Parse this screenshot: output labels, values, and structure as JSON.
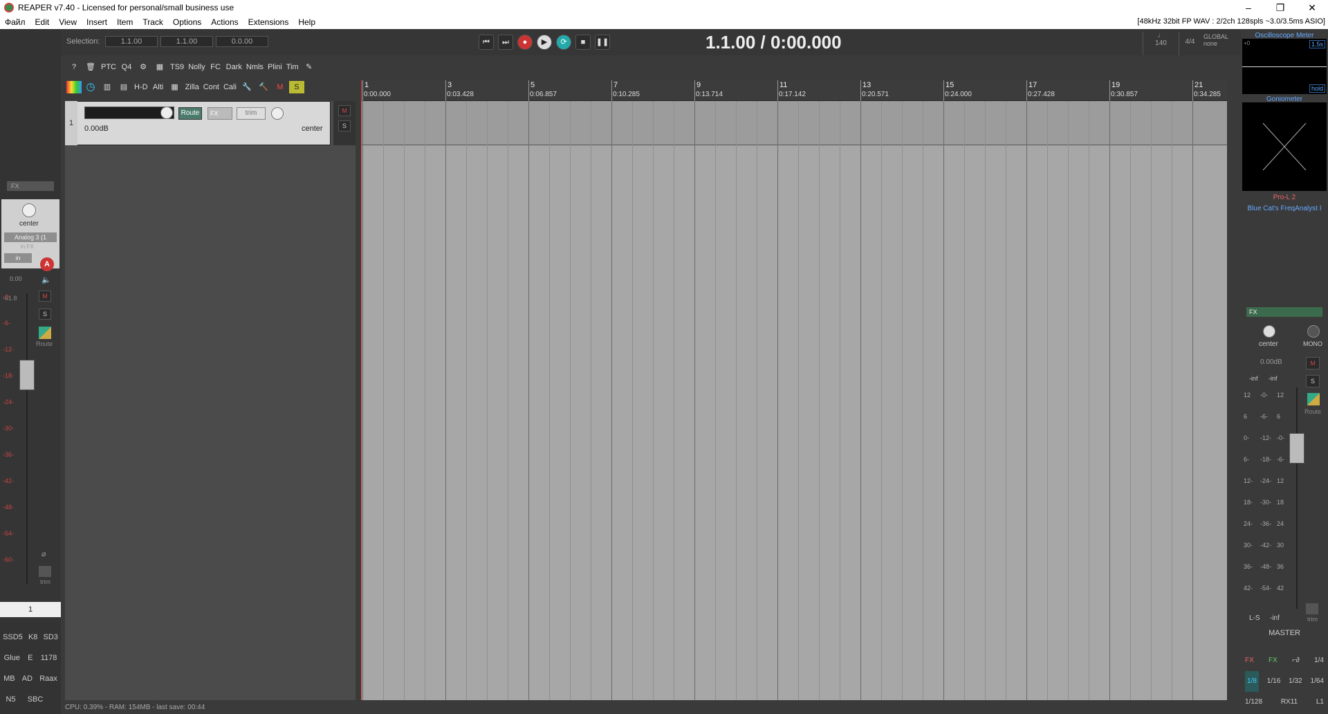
{
  "window": {
    "title": "REAPER v7.40 - Licensed for personal/small business use",
    "controls": [
      "–",
      "❐",
      "✕"
    ]
  },
  "menu": {
    "items": [
      "Файл",
      "Edit",
      "View",
      "Insert",
      "Item",
      "Track",
      "Options",
      "Actions",
      "Extensions",
      "Help"
    ],
    "status": "[48kHz 32bit FP WAV : 2/2ch 128spls ~3.0/3.5ms ASIO]"
  },
  "selection": {
    "label": "Selection:",
    "start": "1.1.00",
    "end": "1.1.00",
    "length": "0.0.00"
  },
  "transport": {
    "time": "1.1.00 / 0:00.000",
    "bpm": "140",
    "timesig": "4/4",
    "global_label": "GLOBAL",
    "global_value": "none"
  },
  "toolbar2": [
    "?",
    "🗑",
    "PTC",
    "Q4",
    "⚙",
    "▦",
    "TS9",
    "Nolly",
    "FC",
    "Dark",
    "Nmls",
    "Plini",
    "Tim",
    "✎"
  ],
  "toolbar3": [
    "",
    "◷",
    "▥",
    "▤",
    "H-D",
    "Alti",
    "▦",
    "Zilla",
    "Cont",
    "Cali",
    "🔧",
    "🔨",
    "M",
    "S"
  ],
  "track": {
    "number": "1",
    "route": "Route",
    "fx": "FX",
    "trim": "trim",
    "volume": "0.00dB",
    "pan": "center",
    "mute": "M",
    "solo": "S"
  },
  "ruler": [
    {
      "bar": "1",
      "time": "0:00.000"
    },
    {
      "bar": "3",
      "time": "0:03.428"
    },
    {
      "bar": "5",
      "time": "0:06.857"
    },
    {
      "bar": "7",
      "time": "0:10.285"
    },
    {
      "bar": "9",
      "time": "0:13.714"
    },
    {
      "bar": "11",
      "time": "0:17.142"
    },
    {
      "bar": "13",
      "time": "0:20.571"
    },
    {
      "bar": "15",
      "time": "0:24.000"
    },
    {
      "bar": "17",
      "time": "0:27.428"
    },
    {
      "bar": "19",
      "time": "0:30.857"
    },
    {
      "bar": "21",
      "time": "0:34.285"
    }
  ],
  "statusbar": "CPU: 0.39% - RAM: 154MB - last save: 00:44",
  "mixer": {
    "fx": "FX",
    "pan": "center",
    "input": "Analog 3 (1",
    "infx": "in FX",
    "mode": "in",
    "rec": "A",
    "vol": "0.00",
    "peak": "-61.8",
    "mute": "M",
    "solo": "S",
    "route": "Route",
    "trim": "trim",
    "number": "1",
    "scale": [
      "-0-",
      "-6-",
      "-12-",
      "-18-",
      "-24-",
      "-30-",
      "-36-",
      "-42-",
      "-48-",
      "-54-",
      "-60-"
    ]
  },
  "leftbuttons": [
    [
      "SSD5",
      "K8",
      "SD3"
    ],
    [
      "Glue",
      "E",
      "1178"
    ],
    [
      "MB",
      "AD",
      "Raax"
    ],
    [
      "N5",
      "SBC",
      ""
    ]
  ],
  "rightpanel": {
    "osc_title": "Oscilloscope Meter",
    "osc_val": "1.5s",
    "osc_hold": "hold",
    "osc_zero": "+0",
    "gonio_title": "Goniometer",
    "prol": "Pro-L 2",
    "freq": "Blue Cat's FreqAnalyst I",
    "master_fx": "FX",
    "pan": "center",
    "mono": "MONO",
    "vol": "0.00dB",
    "inf_l": "-inf",
    "inf_r": "-inf",
    "mute": "M",
    "solo": "S",
    "route": "Route",
    "trim": "trim",
    "ls": "L-S",
    "ls_val": "-inf",
    "master": "MASTER",
    "scale_l": [
      "12",
      "6",
      "0-",
      "6-",
      "12-",
      "18-",
      "24-",
      "30-",
      "36-",
      "42-"
    ],
    "scale_m": [
      "-0-",
      "-6-",
      "-12-",
      "-18-",
      "-24-",
      "-30-",
      "-36-",
      "-42-",
      "-48-",
      "-54-"
    ],
    "scale_r": [
      "12",
      "6",
      "-0-",
      "-6-",
      "12",
      "18",
      "24",
      "30",
      "36",
      "42"
    ],
    "grid": [
      [
        "FX",
        "FX",
        "⌐∂",
        "1/4"
      ],
      [
        "1/8",
        "1/16",
        "1/32",
        "1/64"
      ],
      [
        "1/128",
        "RX11",
        "L1"
      ]
    ]
  }
}
